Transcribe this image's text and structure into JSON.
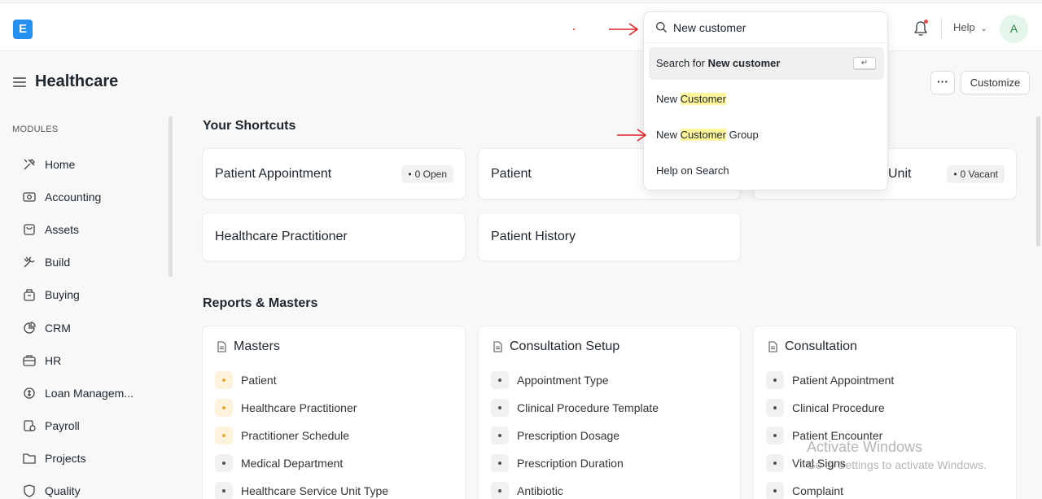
{
  "navbar": {
    "logo_letter": "E",
    "help_label": "Help",
    "avatar_initial": "A"
  },
  "header": {
    "title": "Healthcare",
    "more_label": "···",
    "customize_label": "Customize"
  },
  "sidebar": {
    "section_label": "MODULES",
    "items": [
      {
        "label": "Home",
        "icon": "tools-icon"
      },
      {
        "label": "Accounting",
        "icon": "money-icon"
      },
      {
        "label": "Assets",
        "icon": "box-icon"
      },
      {
        "label": "Build",
        "icon": "wrench-icon"
      },
      {
        "label": "Buying",
        "icon": "bag-icon"
      },
      {
        "label": "CRM",
        "icon": "chart-pie-icon"
      },
      {
        "label": "HR",
        "icon": "briefcase-icon"
      },
      {
        "label": "Loan Managem...",
        "icon": "loan-icon"
      },
      {
        "label": "Payroll",
        "icon": "payroll-icon"
      },
      {
        "label": "Projects",
        "icon": "folder-icon"
      },
      {
        "label": "Quality",
        "icon": "shield-icon"
      }
    ]
  },
  "shortcuts": {
    "title": "Your Shortcuts",
    "items": [
      {
        "label": "Patient Appointment",
        "badge": "0 Open"
      },
      {
        "label": "Patient",
        "badge": ""
      },
      {
        "label": "Unit",
        "badge": "0 Vacant"
      },
      {
        "label": "Healthcare Practitioner",
        "badge": ""
      },
      {
        "label": "Patient History",
        "badge": ""
      }
    ]
  },
  "reports": {
    "title": "Reports & Masters",
    "cards": [
      {
        "title": "Masters",
        "links": [
          {
            "label": "Patient",
            "style": "yellow"
          },
          {
            "label": "Healthcare Practitioner",
            "style": "yellow"
          },
          {
            "label": "Practitioner Schedule",
            "style": "yellow"
          },
          {
            "label": "Medical Department",
            "style": "grey"
          },
          {
            "label": "Healthcare Service Unit Type",
            "style": "grey"
          }
        ]
      },
      {
        "title": "Consultation Setup",
        "links": [
          {
            "label": "Appointment Type",
            "style": "grey"
          },
          {
            "label": "Clinical Procedure Template",
            "style": "grey"
          },
          {
            "label": "Prescription Dosage",
            "style": "grey"
          },
          {
            "label": "Prescription Duration",
            "style": "grey"
          },
          {
            "label": "Antibiotic",
            "style": "grey"
          }
        ]
      },
      {
        "title": "Consultation",
        "links": [
          {
            "label": "Patient Appointment",
            "style": "grey"
          },
          {
            "label": "Clinical Procedure",
            "style": "grey"
          },
          {
            "label": "Patient Encounter",
            "style": "grey"
          },
          {
            "label": "Vital Signs",
            "style": "grey"
          },
          {
            "label": "Complaint",
            "style": "grey"
          }
        ]
      }
    ]
  },
  "search": {
    "value": "New customer",
    "results": {
      "search_for_prefix": "Search for ",
      "search_for_term": "New customer",
      "enter_symbol": "↵",
      "r1_prefix": "New ",
      "r1_highlight": "Customer",
      "r2_prefix": "New ",
      "r2_highlight": "Customer",
      "r2_suffix": " Group",
      "help": "Help on Search"
    }
  },
  "watermark": {
    "line1": "Activate Windows",
    "line2": "Go to Settings to activate Windows."
  },
  "colors": {
    "brand": "#2490ef",
    "arrow": "#e02020",
    "highlight": "#fff59d"
  }
}
